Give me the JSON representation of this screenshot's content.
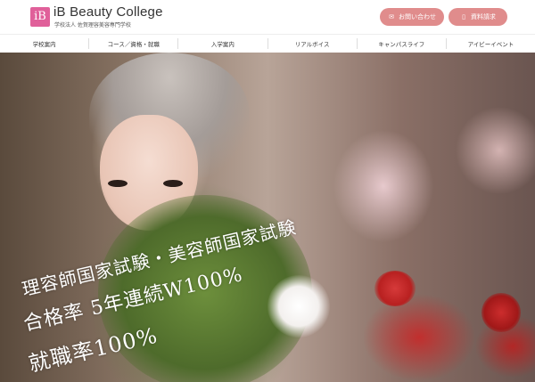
{
  "header": {
    "logo_mark": "iB",
    "title": "iB Beauty College",
    "subtitle": "学校法人 佐賀理容美容専門学校",
    "contact_label": "お問い合わせ",
    "docs_label": "資料請求"
  },
  "nav": {
    "items": [
      {
        "label": "学校案内"
      },
      {
        "label": "コース／資格・就職"
      },
      {
        "label": "入学案内"
      },
      {
        "label": "リアルボイス"
      },
      {
        "label": "キャンパスライフ"
      },
      {
        "label": "アイビーイベント"
      }
    ]
  },
  "hero": {
    "line1": "理容師国家試験・美容師国家試験",
    "line2": "合格率 5年連続W100%",
    "line3": "就職率100%"
  },
  "colors": {
    "brand_pink": "#e0609a",
    "button_pink": "#e08c8c"
  }
}
